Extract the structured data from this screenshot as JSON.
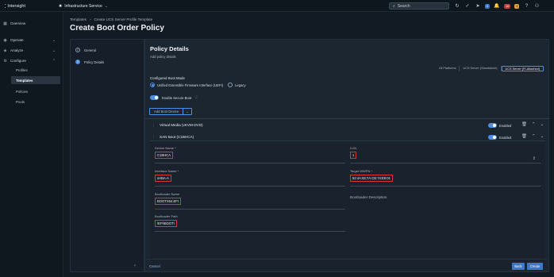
{
  "topbar": {
    "logo_text": "Intersight",
    "service": "Infrastructure Service",
    "search_placeholder": "Search",
    "badge_alerts": "10",
    "badge_warnings": "4",
    "badge_info": "2"
  },
  "sidebar": {
    "overview": "Overview",
    "operate": "Operate",
    "analyze": "Analyze",
    "configure": "Configure",
    "profiles": "Profiles",
    "templates": "Templates",
    "policies": "Policies",
    "pools": "Pools"
  },
  "breadcrumb": [
    "Templates",
    "Create UCS Server Profile Template"
  ],
  "page_title": "Create Boot Order Policy",
  "wizard": {
    "steps": [
      {
        "num": "1",
        "label": "General"
      },
      {
        "num": "2",
        "label": "Policy Details"
      }
    ]
  },
  "main": {
    "title": "Policy Details",
    "subtitle": "Add policy details",
    "tabs": [
      "All Platforms",
      "UCS Server (Standalone)",
      "UCS Server (FI-Attached)"
    ],
    "boot_mode_label": "Configured Boot Mode",
    "boot_mode_uefi": "Unified Extensible Firmware Interface (UEFI)",
    "boot_mode_legacy": "Legacy",
    "secure_boot": "Enable Secure Boot",
    "add_boot_device": "Add Boot Device",
    "devices": [
      {
        "name": "Virtual Media (vKVM-DVD)",
        "enabled": "Enabled"
      },
      {
        "name": "SAN Boot (C1BHCA)",
        "enabled": "Enabled"
      }
    ],
    "form": {
      "device_name_label": "Device Name *",
      "device_name_value": "C1BHCA",
      "lun_label": "LUN",
      "lun_value": "1",
      "interface_label": "Interface Name *",
      "interface_value": "vHBA-A",
      "wwpn_label": "Target WWPN *",
      "wwpn_value": "52:4A:93:7A:CB:74:E9:01",
      "bootloader_name_label": "Bootloader Name",
      "bootloader_name_value": "BOOTX64.EFI",
      "bootloader_desc_placeholder": "Bootloader Description",
      "bootloader_path_label": "Bootloader Path",
      "bootloader_path_value": "\\EFI\\BOOT\\"
    }
  },
  "footer": {
    "cancel": "Cancel",
    "back": "Back",
    "create": "Create"
  }
}
